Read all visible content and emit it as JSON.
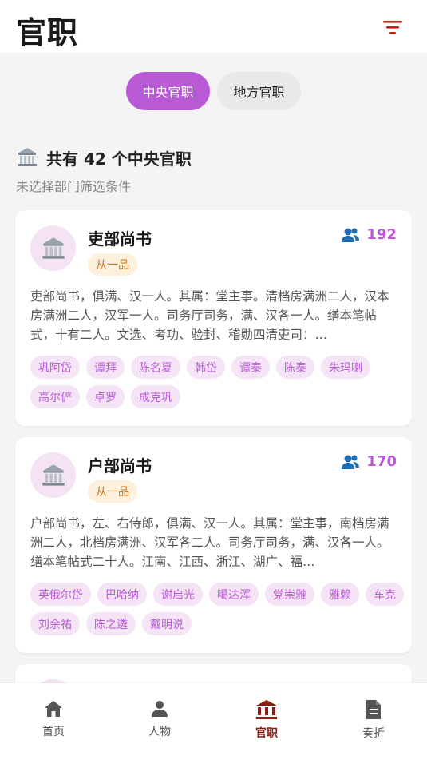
{
  "header": {
    "title": "官职",
    "filter_icon": "filter-icon"
  },
  "tabs": [
    {
      "label": "中央官职",
      "active": true
    },
    {
      "label": "地方官职",
      "active": false
    }
  ],
  "summary": {
    "icon": "bank-icon",
    "text": "共有 42 个中央官职",
    "subtext": "未选择部门筛选条件"
  },
  "cards": [
    {
      "name": "吏部尚书",
      "rank": "从一品",
      "count": "192",
      "desc": "吏部尚书，俱满、汉一人。其属：堂主事。清档房满洲二人，汉本房满洲二人，汉军一人。司务厅司务，满、汉各一人。缮本笔帖式，十有二人。文选、考功、验封、稽勋四清吏司：…",
      "tags": [
        "巩阿岱",
        "谭拜",
        "陈名夏",
        "韩岱",
        "谭泰",
        "陈泰",
        "朱玛喇",
        "高尔俨",
        "卓罗",
        "成克巩"
      ]
    },
    {
      "name": "户部尚书",
      "rank": "从一品",
      "count": "170",
      "desc": "户部尚书，左、右侍郎，俱满、汉一人。其属：堂主事，南档房满洲二人，北档房满洲、汉军各二人。司务厅司务，满、汉各一人。缮本笔帖式二十人。江南、江西、浙江、湖广、福…",
      "tags": [
        "英俄尔岱",
        "巴哈纳",
        "谢启光",
        "噶达浑",
        "党崇雅",
        "雅赖",
        "车克",
        "刘余祐",
        "陈之遴",
        "戴明说"
      ]
    }
  ],
  "nav": [
    {
      "label": "首页",
      "icon": "home-icon",
      "active": false
    },
    {
      "label": "人物",
      "icon": "person-icon",
      "active": false
    },
    {
      "label": "官职",
      "icon": "bank-icon",
      "active": true
    },
    {
      "label": "奏折",
      "icon": "document-icon",
      "active": false
    }
  ],
  "colors": {
    "accent": "#b85ad6",
    "nav_active": "#8c1c12",
    "rank_text": "#c8781e",
    "count_icon": "#1e6fb8"
  }
}
